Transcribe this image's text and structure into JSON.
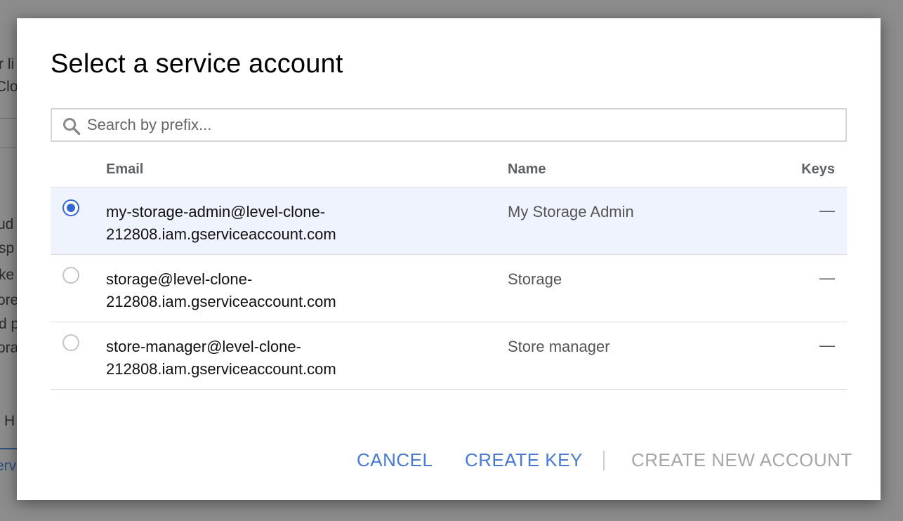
{
  "background": {
    "fragments": [
      "r li",
      "Clo",
      "ud",
      "sp",
      "ke",
      "ore",
      "d p",
      "ora",
      "H",
      "erv"
    ]
  },
  "dialog": {
    "title": "Select a service account",
    "search": {
      "placeholder": "Search by prefix...",
      "value": ""
    },
    "table": {
      "headers": {
        "email": "Email",
        "name": "Name",
        "keys": "Keys"
      },
      "rows": [
        {
          "selected": true,
          "email_line1": "my-storage-admin@level-clone-",
          "email_line2": "212808.iam.gserviceaccount.com",
          "name": "My Storage Admin",
          "keys": "—"
        },
        {
          "selected": false,
          "email_line1": "storage@level-clone-",
          "email_line2": "212808.iam.gserviceaccount.com",
          "name": "Storage",
          "keys": "—"
        },
        {
          "selected": false,
          "email_line1": "store-manager@level-clone-",
          "email_line2": "212808.iam.gserviceaccount.com",
          "name": "Store manager",
          "keys": "—"
        }
      ]
    },
    "actions": {
      "cancel": "CANCEL",
      "create_key": "CREATE KEY",
      "create_new_account": "CREATE NEW ACCOUNT"
    }
  },
  "colors": {
    "accent": "#4779d5",
    "radio_selected": "#3367d6",
    "selected_row": "#eef3fd",
    "disabled_text": "#a6a6a6"
  },
  "icons": [
    "search-icon"
  ]
}
